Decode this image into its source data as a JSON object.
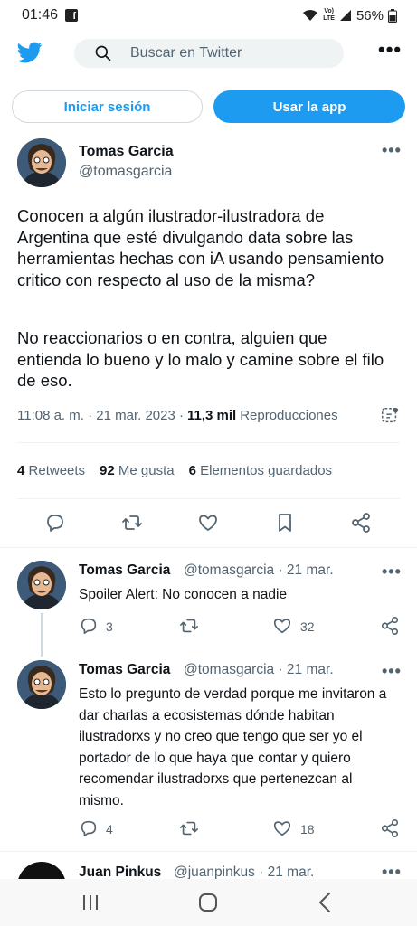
{
  "status": {
    "time": "01:46",
    "battery": "56%",
    "network": "Vo) LTE"
  },
  "search": {
    "placeholder": "Buscar en Twitter"
  },
  "buttons": {
    "login": "Iniciar sesión",
    "app": "Usar la app"
  },
  "tweet": {
    "author_name": "Tomas Garcia",
    "author_handle": "@tomasgarcia",
    "text_p1": "Conocen a algún ilustrador-ilustradora de Argentina que esté divulgando data sobre las herramientas hechas con iA usando pensamiento critico con respecto al uso de la misma?",
    "text_p2": "No reaccionarios o en contra, alguien que entienda lo bueno y lo malo y camine sobre el filo de eso.",
    "time": "11:08 a. m. · 21 mar. 2023 ·",
    "views_count": "11,3 mil",
    "views_label": "Reproducciones",
    "retweets_count": "4",
    "retweets_label": "Retweets",
    "likes_count": "92",
    "likes_label": "Me gusta",
    "bookmarks_count": "6",
    "bookmarks_label": "Elementos guardados"
  },
  "replies": [
    {
      "author_name": "Tomas Garcia",
      "author_handle": "@tomasgarcia · 21 mar.",
      "text": "Spoiler Alert: No conocen a nadie",
      "reply_count": "3",
      "like_count": "32"
    },
    {
      "author_name": "Tomas Garcia",
      "author_handle": "@tomasgarcia · 21 mar.",
      "text": "Esto lo pregunto de verdad porque me invitaron a dar charlas a ecosistemas dónde habitan ilustradorxs y no creo que tengo que ser yo el portador de lo que haya que contar y quiero recomendar ilustradorxs que pertenezcan al mismo.",
      "reply_count": "4",
      "like_count": "18"
    },
    {
      "author_name": "Juan Pinkus",
      "author_handle": "@juanpinkus · 21 mar."
    }
  ],
  "colors": {
    "brand": "#1d9bf0",
    "text": "#0f1419",
    "muted": "#536471"
  }
}
